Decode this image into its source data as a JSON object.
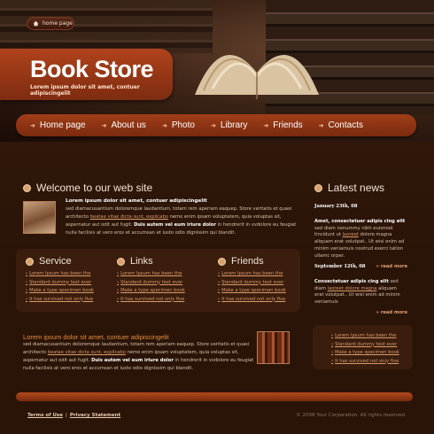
{
  "header": {
    "home_label": "home page",
    "brand_title": "Book Store",
    "brand_tagline": "Lorem ipsum dolor sit amet, contuer adipiscingelit"
  },
  "nav": [
    {
      "label": "Home page"
    },
    {
      "label": "About us"
    },
    {
      "label": "Photo"
    },
    {
      "label": "Library"
    },
    {
      "label": "Friends"
    },
    {
      "label": "Contacts"
    }
  ],
  "welcome": {
    "title": "Welcome to our web site",
    "lead": "Lorem ipsum dolor sit amet, contuer adipiscingelit",
    "p1": "sed diamacusantium doloremque laudantium, totam rem aperiam eaquep. Store veritatis et quasi architecto",
    "link": "beatae vitae dicta sunt, explicabo",
    "p2": "nemo enim ipsam voluptatem, quia voluptas sit, aspernatur aut odit aut fugit.",
    "bold": "Duis autem vel eum iriure dolor",
    "p3": "in hendrerit in vvdolore eu feugiat nulla facilisis at vero eros et accumsan et iusto odio dignissim qui blandit."
  },
  "columns": [
    {
      "title": "Service",
      "links": [
        "Lorem Ipsum has been the",
        "Standard dummy text ever",
        "Make a type specimen book",
        "It has survived not only five"
      ]
    },
    {
      "title": "Links",
      "links": [
        "Lorem Ipsum has been the",
        "Standard dummy text ever",
        "Make a type specimen book",
        "It has survived not only five"
      ]
    },
    {
      "title": "Friends",
      "links": [
        "Lorem Ipsum has been the",
        "Standard dummy text ever",
        "Make a type specimen book",
        "It has survived not only five"
      ]
    }
  ],
  "lower": {
    "title": "Lorem ipsum dolor sit amet, contuer adipiscingelit",
    "p1": "sed diamacusantium doloremque laudantium, totam rem aperiam eaquep. Store veritatis et quasi architecto",
    "link": "beatae vitae dicta sunt, explicabo",
    "p2": "nemo enim ipsam voluptatem, quia voluptas sit, aspernatur aut odit aut fugit.",
    "bold": "Duis autem vel eum iriure dolor",
    "p3": "in hendrerit in vvdolore eu feugiat nulla facilisis at vero eros et accumsan et iusto odio dignissim qui blandit."
  },
  "news": {
    "title": "Latest news",
    "items": [
      {
        "date": "January 23th, 08",
        "lead": "Amet, consectetuer adipis cing elit",
        "body1": "sed diam nonummy nibh euismod tincidunt ut",
        "link": "laoreet",
        "body2": "dolore magna aliquam erat volutpat.. Ut wisi enim ad minim veniamuis nostrud exerci tation ullamc orper.",
        "more": "read more"
      },
      {
        "date": "September 12th, 08",
        "lead": "Consectetuer adipis cing elit",
        "body1": "sed diam",
        "link": "laoreet dolore magna",
        "body2": "aliquam erat volutpat.. Ut wisi enim ad minim veniamuis",
        "more": "read more"
      }
    ],
    "links": [
      "Lorem Ipsum has been the",
      "Standard dummy text ever",
      "Make a type specimen book",
      "It has survived not only five"
    ]
  },
  "footer": {
    "terms": "Terms of Use",
    "privacy": "Privacy Statement",
    "separator": "|",
    "copyright": "© 2008 Your Corporation. All rights reserved"
  }
}
